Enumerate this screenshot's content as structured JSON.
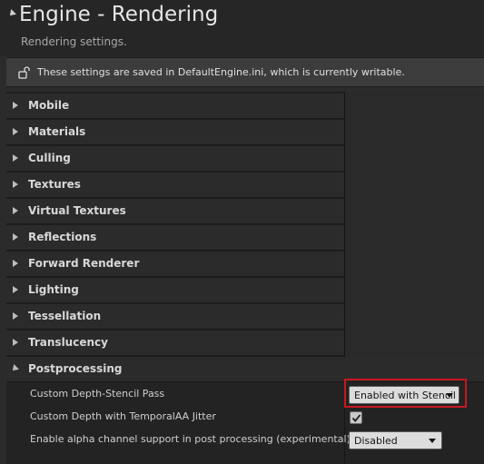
{
  "header": {
    "title": "Engine - Rendering",
    "subtitle": "Rendering settings."
  },
  "notice": {
    "icon": "unlocked-lock-icon",
    "text": "These settings are saved in DefaultEngine.ini, which is currently writable."
  },
  "categories": [
    {
      "label": "Mobile",
      "expanded": false
    },
    {
      "label": "Materials",
      "expanded": false
    },
    {
      "label": "Culling",
      "expanded": false
    },
    {
      "label": "Textures",
      "expanded": false
    },
    {
      "label": "Virtual Textures",
      "expanded": false
    },
    {
      "label": "Reflections",
      "expanded": false
    },
    {
      "label": "Forward Renderer",
      "expanded": false
    },
    {
      "label": "Lighting",
      "expanded": false
    },
    {
      "label": "Tessellation",
      "expanded": false
    },
    {
      "label": "Translucency",
      "expanded": false
    },
    {
      "label": "Postprocessing",
      "expanded": true
    }
  ],
  "postprocessing": {
    "properties": [
      {
        "label": "Custom Depth-Stencil Pass",
        "type": "dropdown",
        "value": "Enabled with Stencil",
        "highlighted": true
      },
      {
        "label": "Custom Depth with TemporalAA Jitter",
        "type": "checkbox",
        "checked": true
      },
      {
        "label": "Enable alpha channel support in post processing (experimental).",
        "type": "dropdown",
        "value": "Disabled"
      }
    ]
  },
  "colors": {
    "highlight": "#c8171f",
    "background": "#2b2b2b"
  }
}
